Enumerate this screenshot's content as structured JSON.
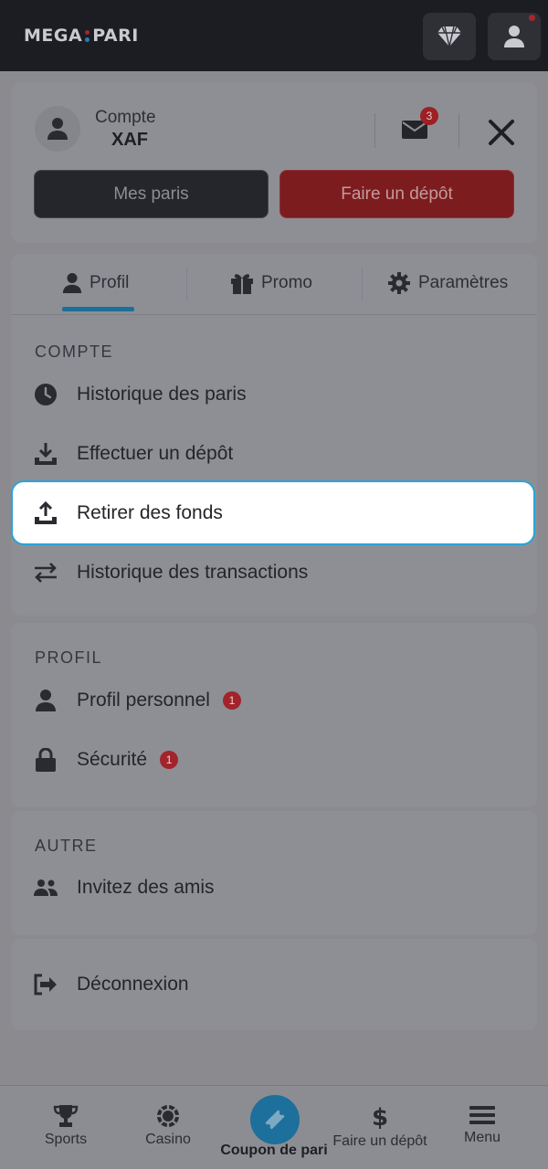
{
  "header": {
    "logo_left": "MEGA",
    "logo_right": "PARI"
  },
  "account": {
    "label": "Compte",
    "currency": "XAF",
    "mail_count": "3",
    "my_bets_label": "Mes paris",
    "deposit_label": "Faire un dépôt"
  },
  "tabs": [
    {
      "label": "Profil"
    },
    {
      "label": "Promo"
    },
    {
      "label": "Paramètres"
    }
  ],
  "sections": {
    "compte": {
      "title": "COMPTE",
      "items": [
        {
          "label": "Historique des paris"
        },
        {
          "label": "Effectuer un dépôt"
        },
        {
          "label": "Retirer des fonds"
        },
        {
          "label": "Historique des transactions"
        }
      ]
    },
    "profil": {
      "title": "PROFIL",
      "items": [
        {
          "label": "Profil personnel",
          "badge": "1"
        },
        {
          "label": "Sécurité",
          "badge": "1"
        }
      ]
    },
    "autre": {
      "title": "AUTRE",
      "items": [
        {
          "label": "Invitez des amis"
        }
      ]
    },
    "logout": {
      "label": "Déconnexion"
    }
  },
  "bottom_nav": [
    {
      "label": "Sports"
    },
    {
      "label": "Casino"
    },
    {
      "label": "Coupon de pari"
    },
    {
      "label": "Faire un dépôt"
    },
    {
      "label": "Menu"
    }
  ],
  "colors": {
    "accent_blue": "#2aa3d8",
    "brand_red": "#7c1c1f",
    "badge_red": "#a3232a"
  }
}
